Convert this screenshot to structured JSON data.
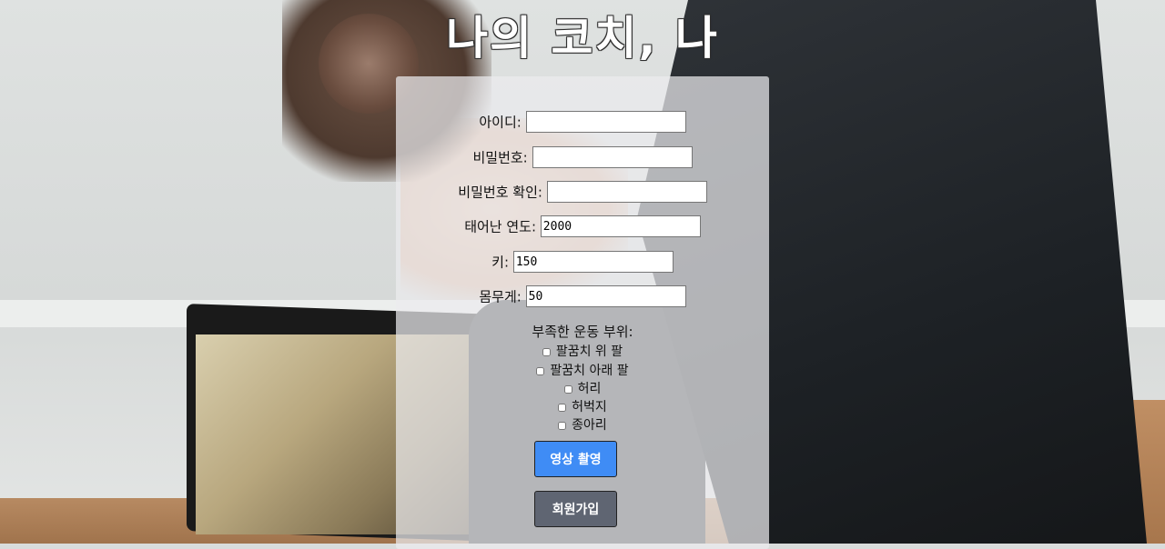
{
  "title": "나의 코치, 나",
  "form": {
    "id_label": "아이디:",
    "id_value": "",
    "password_label": "비밀번호:",
    "password_value": "",
    "password_confirm_label": "비밀번호 확인:",
    "password_confirm_value": "",
    "birth_year_label": "태어난 연도:",
    "birth_year_value": "2000",
    "height_label": "키:",
    "height_value": "150",
    "weight_label": "몸무게:",
    "weight_value": "50",
    "weak_parts_label": "부족한 운동 부위:",
    "weak_parts": [
      {
        "label": "팔꿈치 위 팔",
        "checked": false
      },
      {
        "label": "팔꿈치 아래 팔",
        "checked": false
      },
      {
        "label": "허리",
        "checked": false
      },
      {
        "label": "허벅지",
        "checked": false
      },
      {
        "label": "종아리",
        "checked": false
      }
    ],
    "video_button": "영상 촬영",
    "signup_button": "회원가입"
  },
  "colors": {
    "video_button": "#3f8cf5",
    "signup_button": "#5f6572",
    "title_text": "#ffffff"
  }
}
